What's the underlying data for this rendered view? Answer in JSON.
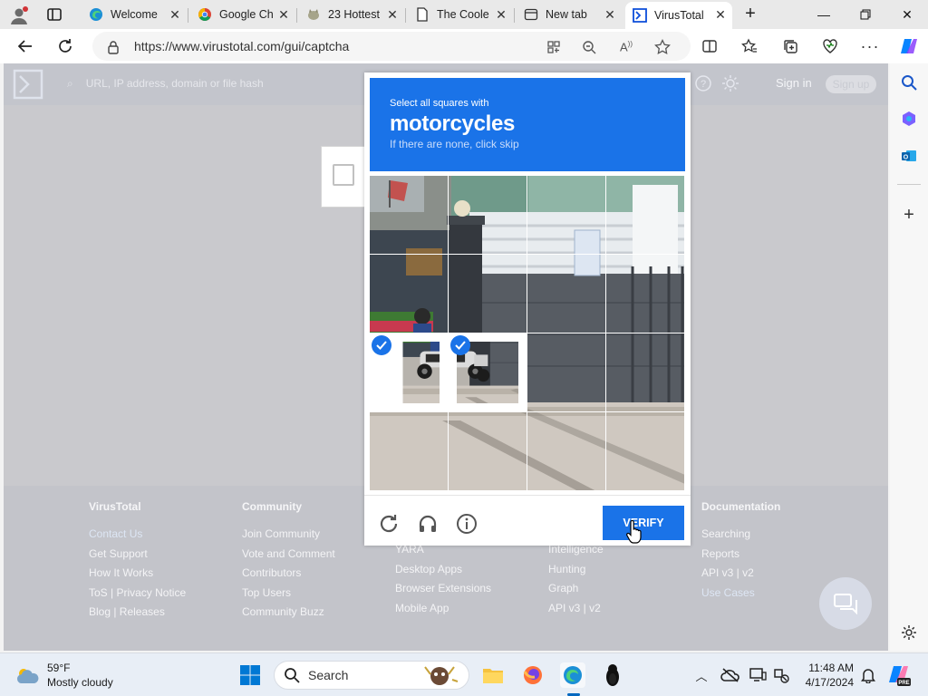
{
  "browser": {
    "tabs": [
      {
        "title": "Welcome",
        "icon": "edge-icon"
      },
      {
        "title": "Google Ch",
        "icon": "chrome-icon"
      },
      {
        "title": "23 Hottest",
        "icon": "cat-icon"
      },
      {
        "title": "The Coole",
        "icon": "document-icon"
      },
      {
        "title": "New tab",
        "icon": "newtab-icon"
      },
      {
        "title": "VirusTotal",
        "icon": "virustotal-icon",
        "active": true
      }
    ],
    "url": "https://www.virustotal.com/gui/captcha"
  },
  "virustotal": {
    "search_placeholder": "URL, IP address, domain or file hash",
    "sign_in": "Sign in",
    "sign_up": "Sign up",
    "footer": [
      {
        "heading": "VirusTotal",
        "links": [
          "Contact Us",
          "Get Support",
          "How It Works",
          "ToS | Privacy Notice",
          "Blog | Releases"
        ]
      },
      {
        "heading": "Community",
        "links": [
          "Join Community",
          "Vote and Comment",
          "Contributors",
          "Top Users",
          "Community Buzz"
        ]
      },
      {
        "heading": "",
        "links": [
          "YARA",
          "Desktop Apps",
          "Browser Extensions",
          "Mobile App"
        ]
      },
      {
        "heading": "",
        "links": [
          "Intelligence",
          "Hunting",
          "Graph",
          "API v3 | v2"
        ]
      },
      {
        "heading": "Documentation",
        "links": [
          "Searching",
          "Reports",
          "API v3 | v2",
          "Use Cases"
        ]
      }
    ]
  },
  "captcha": {
    "instruction": "Select all squares with",
    "target": "motorcycles",
    "hint": "If there are none, click skip",
    "selected_tiles": [
      8,
      9
    ],
    "verify_label": "VERIFY",
    "accent": "#1a73e8"
  },
  "taskbar": {
    "weather_temp": "59°F",
    "weather_desc": "Mostly cloudy",
    "search_label": "Search",
    "time": "11:48 AM",
    "date": "4/17/2024"
  }
}
